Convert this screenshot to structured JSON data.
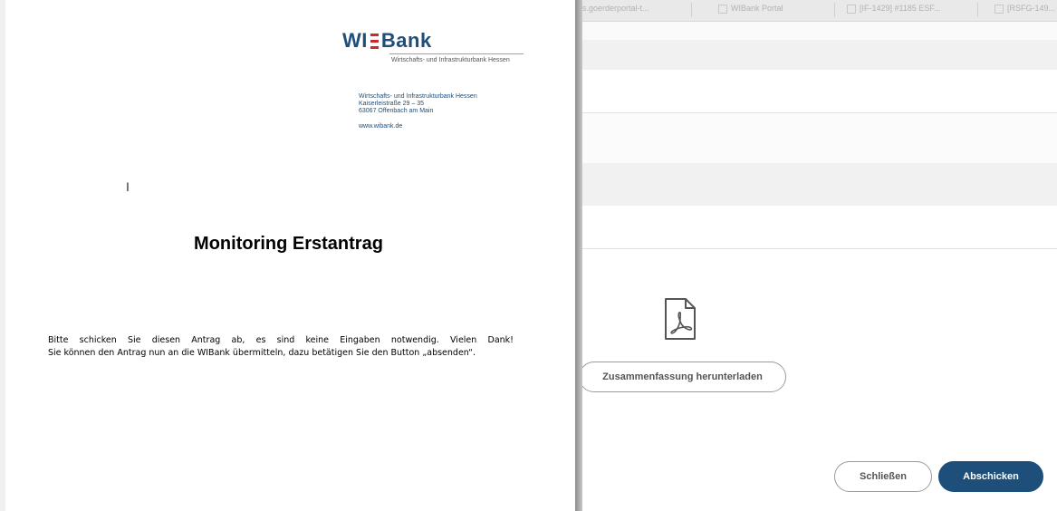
{
  "document": {
    "logo": {
      "brand_left": "WI",
      "brand_right": "Bank",
      "tagline": "Wirtschafts- und Infrastrukturbank Hessen"
    },
    "address": {
      "line1": "Wirtschafts- und Infrastrukturbank Hessen",
      "line2": "Kaiserleistraße 29 – 35",
      "line3": "63067 Offenbach am Main",
      "website": "www.wibank.de"
    },
    "title": "Monitoring Erstantrag",
    "body_line1": "Bitte schicken Sie diesen Antrag ab, es sind keine Eingaben notwendig. Vielen Dank!",
    "body_line2": "Sie können den Antrag nun an die WIBank übermitteln, dazu betätigen Sie den Button „absenden“."
  },
  "browser_tabs": [
    {
      "label": "s.goerderportal-t..."
    },
    {
      "label": "WIBank Portal"
    },
    {
      "label": "[IF-1429] #1185 ESF..."
    },
    {
      "label": "[RSFG-149..."
    }
  ],
  "dialog": {
    "download_button": "Zusammenfassung herunterladen",
    "close_button": "Schließen",
    "submit_button": "Abschicken"
  },
  "colors": {
    "brand": "#1d4f7a",
    "logo_red": "#d8232a"
  },
  "icons": {
    "file": "pdf-file-icon",
    "cursor": "text-cursor-icon"
  }
}
